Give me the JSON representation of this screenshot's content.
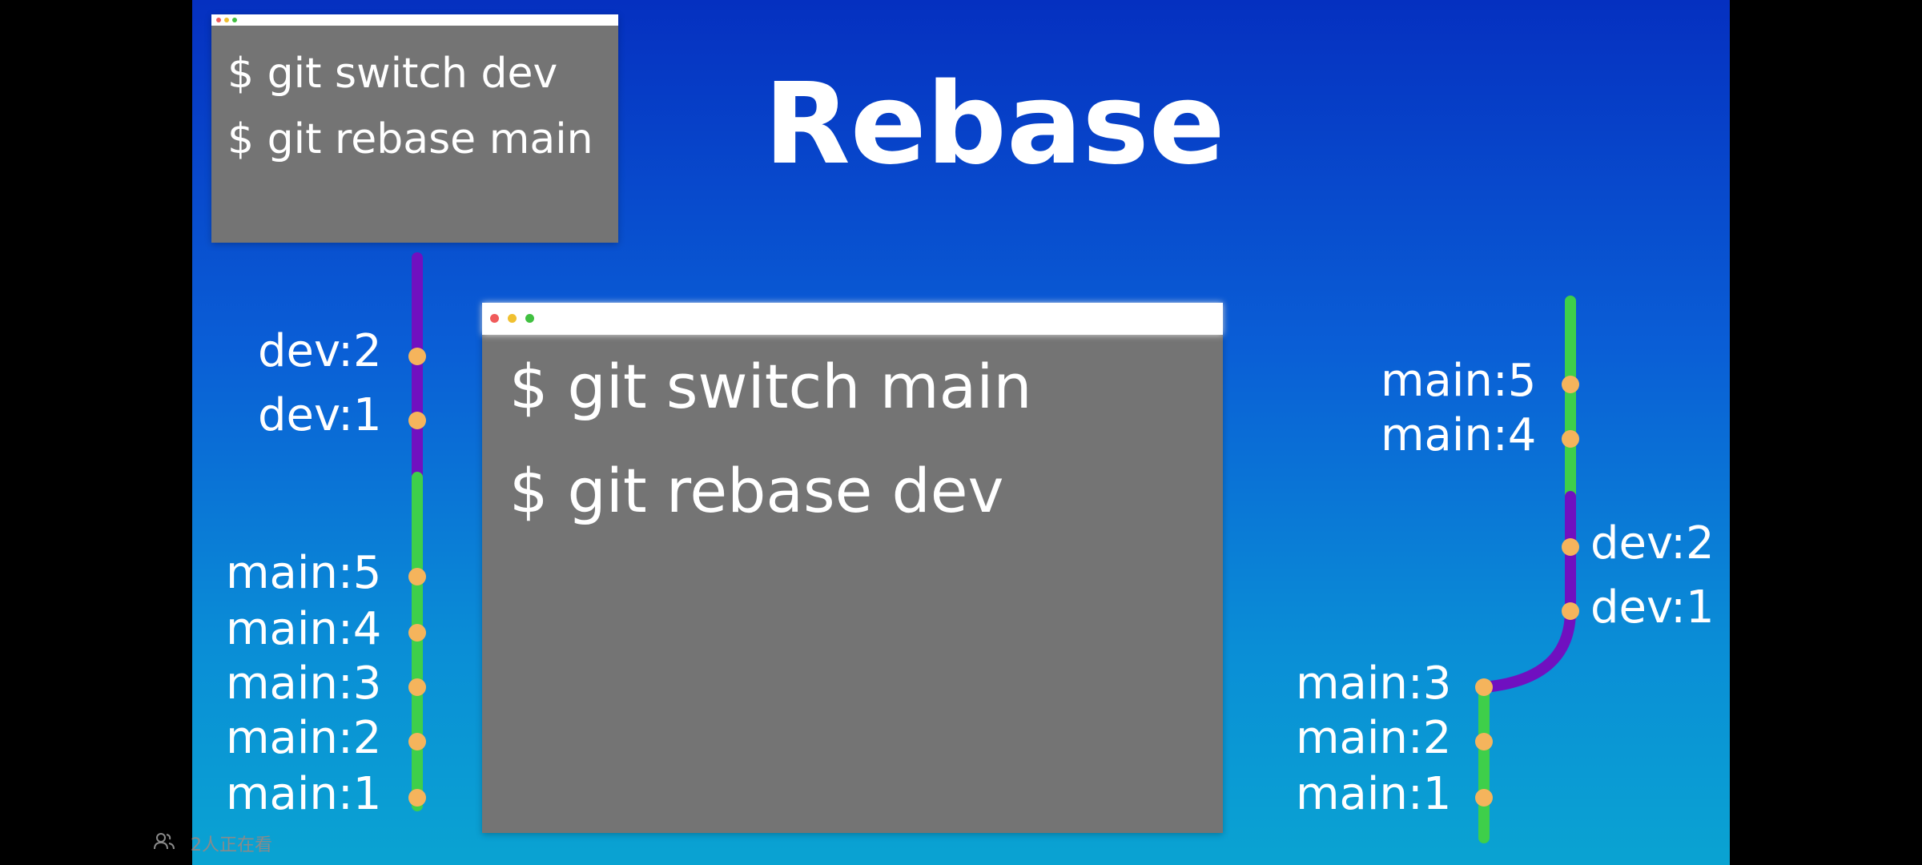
{
  "slide": {
    "title": "Rebase",
    "terminal_small": {
      "lines": [
        "$ git switch dev",
        "$ git rebase main"
      ]
    },
    "terminal_large": {
      "lines": [
        "$ git switch main",
        "$ git rebase dev"
      ]
    },
    "left_graph": {
      "commits": [
        "dev:2",
        "dev:1",
        "main:5",
        "main:4",
        "main:3",
        "main:2",
        "main:1"
      ]
    },
    "right_graph": {
      "commits": [
        "main:5",
        "main:4",
        "dev:2",
        "dev:1",
        "main:3",
        "main:2",
        "main:1"
      ]
    },
    "colors": {
      "main_branch": "#3ecf4a",
      "dev_branch": "#7010c0",
      "commit_dot": "#f5b45c",
      "terminal_bg": "#747474"
    }
  },
  "watchers": {
    "text": "2人正在看",
    "icon": "people-icon"
  }
}
